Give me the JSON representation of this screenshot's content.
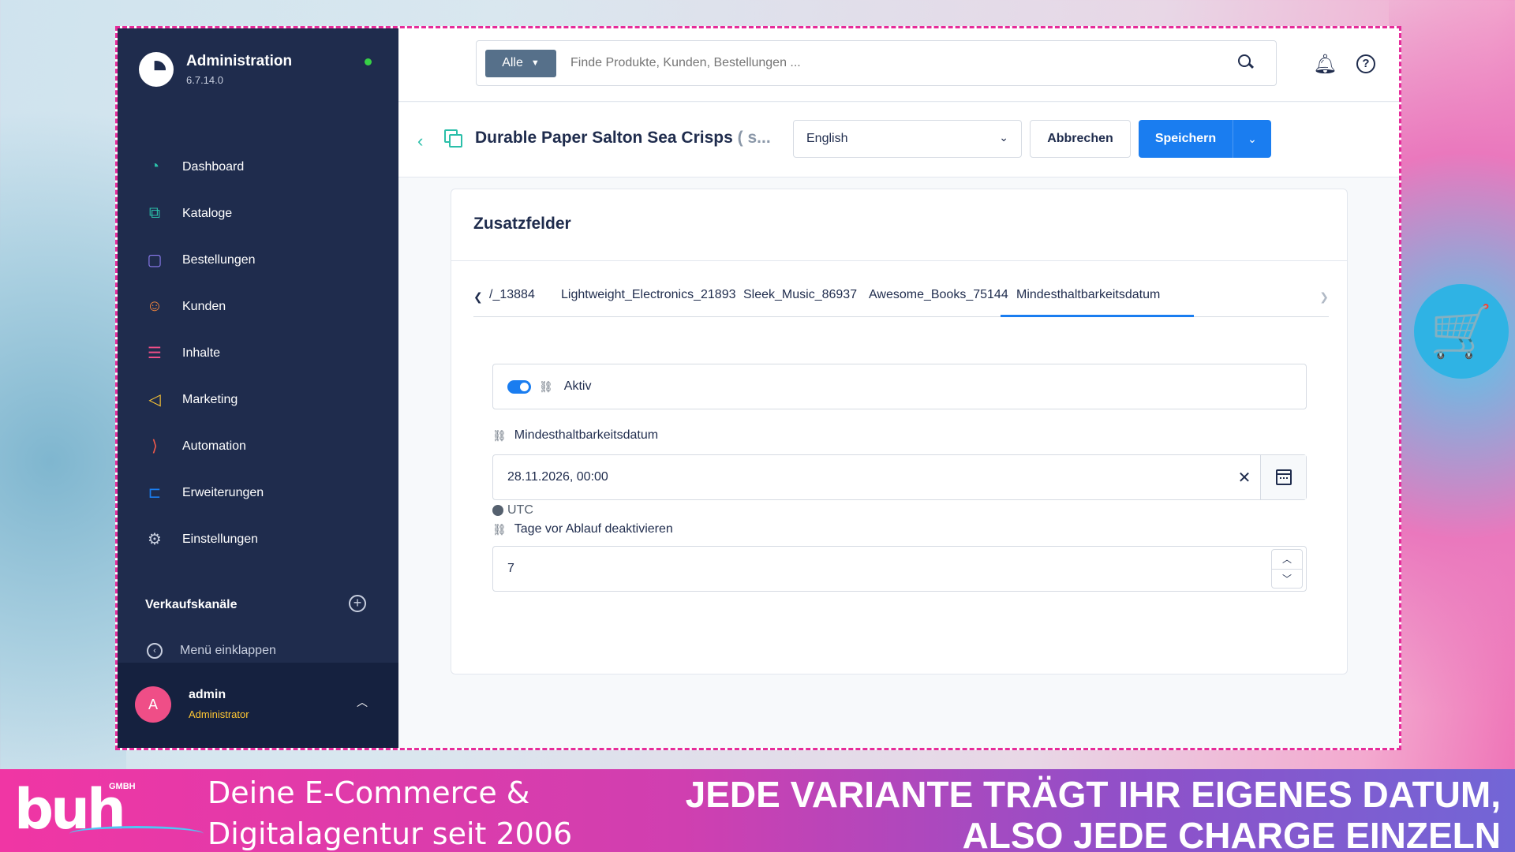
{
  "sidebar": {
    "brand_title": "Administration",
    "brand_version": "6.7.14.0",
    "items": [
      {
        "label": "Dashboard",
        "icon": "gauge-icon",
        "color": "#2bbfa9",
        "glyph": "◔"
      },
      {
        "label": "Kataloge",
        "icon": "catalog-icon",
        "color": "#2bbfa9",
        "glyph": "⧉"
      },
      {
        "label": "Bestellungen",
        "icon": "shopping-bag-icon",
        "color": "#8c7cf0",
        "glyph": "▢"
      },
      {
        "label": "Kunden",
        "icon": "users-icon",
        "color": "#f6873d",
        "glyph": "☺"
      },
      {
        "label": "Inhalte",
        "icon": "content-icon",
        "color": "#ef4e87",
        "glyph": "☰"
      },
      {
        "label": "Marketing",
        "icon": "megaphone-icon",
        "color": "#ffc733",
        "glyph": "◁"
      },
      {
        "label": "Automation",
        "icon": "automation-icon",
        "color": "#f35a4a",
        "glyph": "⟩"
      },
      {
        "label": "Erweiterungen",
        "icon": "plugin-icon",
        "color": "#1a7df0",
        "glyph": "⊏"
      },
      {
        "label": "Einstellungen",
        "icon": "gear-icon",
        "color": "#c8cfdf",
        "glyph": "⚙"
      }
    ],
    "sales_channels": "Verkaufskanäle",
    "collapse_label": "Menü einklappen",
    "user_initial": "A",
    "user_name": "admin",
    "user_role": "Administrator"
  },
  "topbar": {
    "search_scope": "Alle",
    "search_placeholder": "Finde Produkte, Kunden, Bestellungen ..."
  },
  "smartbar": {
    "title": "Durable Paper Salton Sea Crisps",
    "title_suffix": "( s...",
    "language": "English",
    "cancel_label": "Abbrechen",
    "save_label": "Speichern"
  },
  "card": {
    "title": "Zusatzfelder",
    "tabs": [
      {
        "label": "/_13884",
        "active": false
      },
      {
        "label": "Lightweight_Electronics_21893",
        "active": false
      },
      {
        "label": "Sleek_Music_86937",
        "active": false
      },
      {
        "label": "Awesome_Books_75144",
        "active": false
      },
      {
        "label": "Mindesthaltbarkeitsdatum",
        "active": true
      }
    ],
    "active_label": "Aktiv",
    "active_on": true,
    "date_label": "Mindesthaltbarkeitsdatum",
    "date_value": "28.11.2026, 00:00",
    "timezone": "UTC",
    "days_label": "Tage vor Ablauf deaktivieren",
    "days_value": "7"
  },
  "footer": {
    "logo_text": "buh",
    "logo_sub": "GMBH",
    "tagline_line1": "Deine E-Commerce &",
    "tagline_line2": "Digitalagentur seit 2006",
    "headline_line1": "JEDE VARIANTE TRÄGT IHR EIGENES DATUM,",
    "headline_line2": "ALSO JEDE CHARGE EINZELN"
  },
  "colors": {
    "sidebar_bg": "#1f2c4d",
    "primary": "#1a7df0",
    "accent_teal": "#2bbfa9",
    "status_online": "#37d046",
    "frame_border": "#e62c9a"
  }
}
